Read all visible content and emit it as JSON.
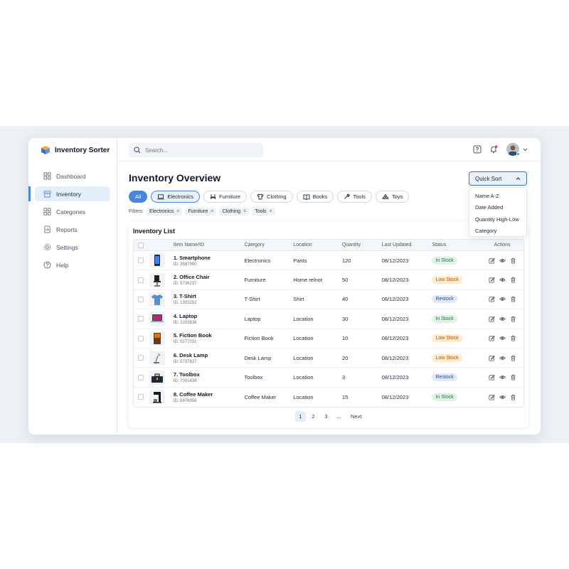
{
  "app": {
    "brand": "Inventory Sorter"
  },
  "sidebar": {
    "items": [
      {
        "label": "Dashboard",
        "icon": "grid-icon"
      },
      {
        "label": "Inventory",
        "icon": "box-icon",
        "active": true
      },
      {
        "label": "Categories",
        "icon": "grid-icon"
      },
      {
        "label": "Reports",
        "icon": "report-icon"
      },
      {
        "label": "Settings",
        "icon": "gear-icon"
      },
      {
        "label": "Help",
        "icon": "help-icon"
      }
    ]
  },
  "topbar": {
    "search_placeholder": "Search...",
    "icons": [
      "help-icon",
      "bell-icon",
      "avatar",
      "chevron-down-icon"
    ]
  },
  "main": {
    "title": "Inventory Overview",
    "quick_sort": {
      "label": "Quick Sort",
      "options": [
        "Name A-Z",
        "Date Added",
        "Quantity High-Low",
        "Category"
      ]
    },
    "chips": [
      {
        "label": "All",
        "icon": ""
      },
      {
        "label": "Electronics",
        "icon": "laptop-icon"
      },
      {
        "label": "Furniture",
        "icon": "chair-icon"
      },
      {
        "label": "Clothing",
        "icon": "shirt-icon"
      },
      {
        "label": "Books",
        "icon": "book-icon"
      },
      {
        "label": "Tools",
        "icon": "wrench-icon"
      },
      {
        "label": "Toys",
        "icon": "toy-icon"
      }
    ],
    "filters": {
      "label": "Filters:",
      "tags": [
        "Electronics",
        "Furniture",
        "Clothing",
        "Tools"
      ],
      "remove_glyphs": [
        "×",
        "×",
        "=",
        "×"
      ]
    }
  },
  "table": {
    "title": "Inventory List",
    "columns": [
      "Item Name/ID",
      "Category",
      "Location",
      "Quantity",
      "Last Updated",
      "Status",
      "Actions"
    ],
    "rows": [
      {
        "name": "1. Smartphone",
        "id": "ID: 3587900",
        "category": "Electronics",
        "location": "Pants",
        "quantity": "120",
        "updated": "08/12/2023",
        "status": "In Stock",
        "thumb": "phone"
      },
      {
        "name": "2. Office Chair",
        "id": "ID: 5736237",
        "category": "Furniture",
        "location": "Home relnot",
        "quantity": "50",
        "updated": "08/12/2023",
        "status": "Low Stock",
        "thumb": "chair"
      },
      {
        "name": "3. T-Shirt",
        "id": "ID: 1303252",
        "category": "T-Shirt",
        "location": "Shirt",
        "quantity": "40",
        "updated": "08/12/2023",
        "status": "Restock",
        "thumb": "shirt"
      },
      {
        "name": "4. Laptop",
        "id": "ID: 2203838",
        "category": "Laptop",
        "location": "Location",
        "quantity": "30",
        "updated": "08/12/2023",
        "status": "In Stock",
        "thumb": "laptop"
      },
      {
        "name": "5. Fiction Book",
        "id": "ID: 5277031",
        "category": "Fiction Book",
        "location": "Location",
        "quantity": "10",
        "updated": "08/12/2023",
        "status": "Low Stock",
        "thumb": "book"
      },
      {
        "name": "6. Desk Lamp",
        "id": "ID: 5737827",
        "category": "Desk Lamp",
        "location": "Location",
        "quantity": "20",
        "updated": "08/12/2023",
        "status": "Low Stock",
        "thumb": "lamp"
      },
      {
        "name": "7. Toolbox",
        "id": "ID: 7001834",
        "category": "Toolbox",
        "location": "Location",
        "quantity": "3",
        "updated": "08/12/2023",
        "status": "Restock",
        "thumb": "toolbox"
      },
      {
        "name": "8. Coffee Maker",
        "id": "ID: 6876058",
        "category": "Coffee Maker",
        "location": "Location",
        "quantity": "15",
        "updated": "08/12/2023",
        "status": "In Stock",
        "thumb": "coffee"
      }
    ]
  },
  "pagination": {
    "pages": [
      "1",
      "2",
      "3",
      "..."
    ],
    "current": "1",
    "next": "Next"
  },
  "colors": {
    "accent": "#4a86d8",
    "in_stock": "#15803d",
    "low_stock": "#b45309",
    "restock": "#1e4f9c",
    "online": "#22c55e"
  }
}
